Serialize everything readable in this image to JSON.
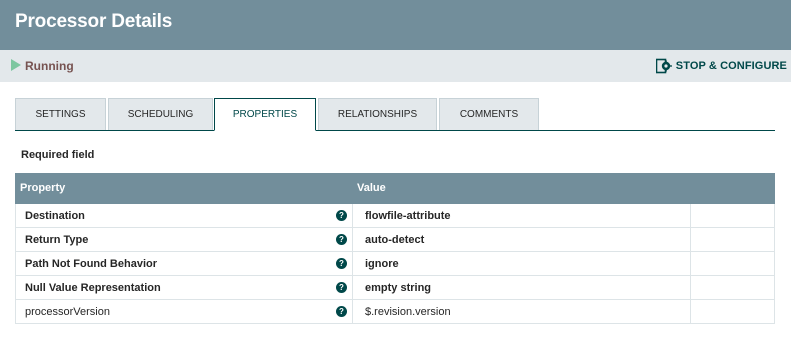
{
  "header": {
    "title": "Processor Details"
  },
  "status": {
    "state_label": "Running",
    "action_label": "STOP & CONFIGURE"
  },
  "tabs": [
    {
      "label": "SETTINGS",
      "active": false
    },
    {
      "label": "SCHEDULING",
      "active": false
    },
    {
      "label": "PROPERTIES",
      "active": true
    },
    {
      "label": "RELATIONSHIPS",
      "active": false
    },
    {
      "label": "COMMENTS",
      "active": false
    }
  ],
  "required_field_label": "Required field",
  "grid": {
    "columns": {
      "property": "Property",
      "value": "Value"
    },
    "rows": [
      {
        "name": "Destination",
        "value": "flowfile-attribute",
        "required": true
      },
      {
        "name": "Return Type",
        "value": "auto-detect",
        "required": true
      },
      {
        "name": "Path Not Found Behavior",
        "value": "ignore",
        "required": true
      },
      {
        "name": "Null Value Representation",
        "value": "empty string",
        "required": true
      },
      {
        "name": "processorVersion",
        "value": "$.revision.version",
        "required": false
      }
    ]
  },
  "colors": {
    "header_bg": "#728e9b",
    "status_bg": "#e3e8eb",
    "running_icon": "#7dc7a0",
    "accent": "#004849"
  },
  "icons": {
    "run": "play-icon",
    "stop_configure": "stop-configure-icon",
    "help": "question-circle-icon"
  }
}
